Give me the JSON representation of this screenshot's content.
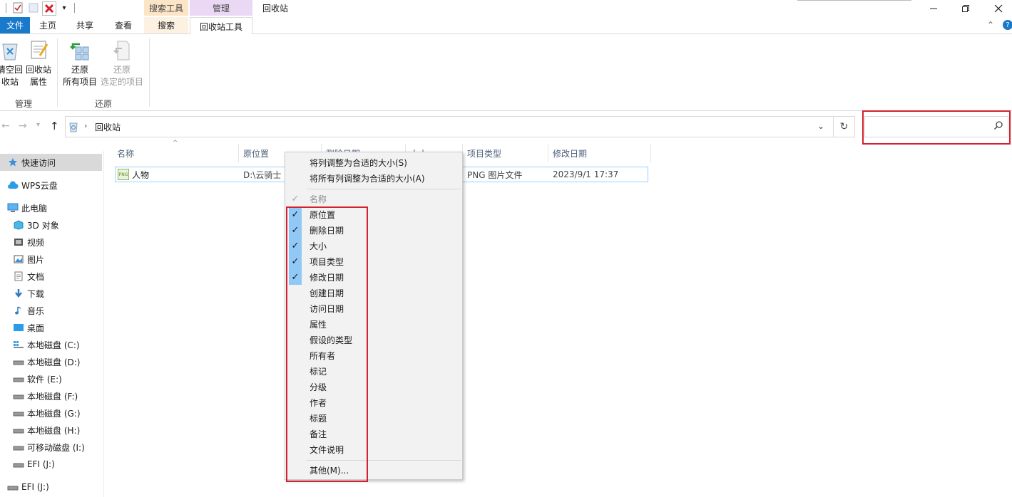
{
  "window": {
    "title": "回收站",
    "context_group_search": "搜索工具",
    "context_group_manage": "管理"
  },
  "tabs": {
    "file": "文件",
    "home": "主页",
    "share": "共享",
    "view": "查看",
    "search": "搜索",
    "recycle_tools": "回收站工具"
  },
  "ribbon": {
    "empty_line1": "清空回",
    "empty_line2": "收站",
    "props_line1": "回收站",
    "props_line2": "属性",
    "group_manage": "管理",
    "restore_all_line1": "还原",
    "restore_all_line2": "所有项目",
    "restore_sel_line1": "还原",
    "restore_sel_line2": "选定的项目",
    "group_restore": "还原"
  },
  "address": {
    "path": "回收站",
    "search_placeholder": ""
  },
  "nav": {
    "quick_access": "快速访问",
    "wps_cloud": "WPS云盘",
    "this_pc": "此电脑",
    "objects3d": "3D 对象",
    "videos": "视频",
    "pictures": "图片",
    "documents": "文档",
    "downloads": "下载",
    "music": "音乐",
    "desktop": "桌面",
    "drive_c": "本地磁盘 (C:)",
    "drive_d": "本地磁盘 (D:)",
    "drive_e": "软件 (E:)",
    "drive_f": "本地磁盘 (F:)",
    "drive_g": "本地磁盘 (G:)",
    "drive_h": "本地磁盘 (H:)",
    "drive_i": "可移动磁盘 (I:)",
    "drive_j": "EFI (J:)",
    "drive_j2": "EFI (J:)"
  },
  "columns": {
    "name": "名称",
    "orig_location": "原位置",
    "delete_date": "删除日期",
    "size": "大小",
    "item_type": "项目类型",
    "modified": "修改日期"
  },
  "file": {
    "icon_text": "PNG",
    "name": "人物",
    "orig_location": "D:\\云骑士",
    "item_type": "PNG 图片文件",
    "modified": "2023/9/1 17:37"
  },
  "context_menu": {
    "fit_column": "将列调整为合适的大小(S)",
    "fit_all_columns": "将所有列调整为合适的大小(A)",
    "name": "名称",
    "orig_location": "原位置",
    "delete_date": "删除日期",
    "size": "大小",
    "item_type": "项目类型",
    "modified": "修改日期",
    "created": "创建日期",
    "accessed": "访问日期",
    "attributes": "属性",
    "perceived_type": "假设的类型",
    "owner": "所有者",
    "tags": "标记",
    "rating": "分级",
    "authors": "作者",
    "title": "标题",
    "comments": "备注",
    "file_description": "文件说明",
    "more": "其他(M)..."
  },
  "colors": {
    "accent": "#1979ca",
    "highlight_red": "#d1222d",
    "search_tab_bg": "#fce4c7",
    "manage_tab_bg": "#ead8f5"
  }
}
